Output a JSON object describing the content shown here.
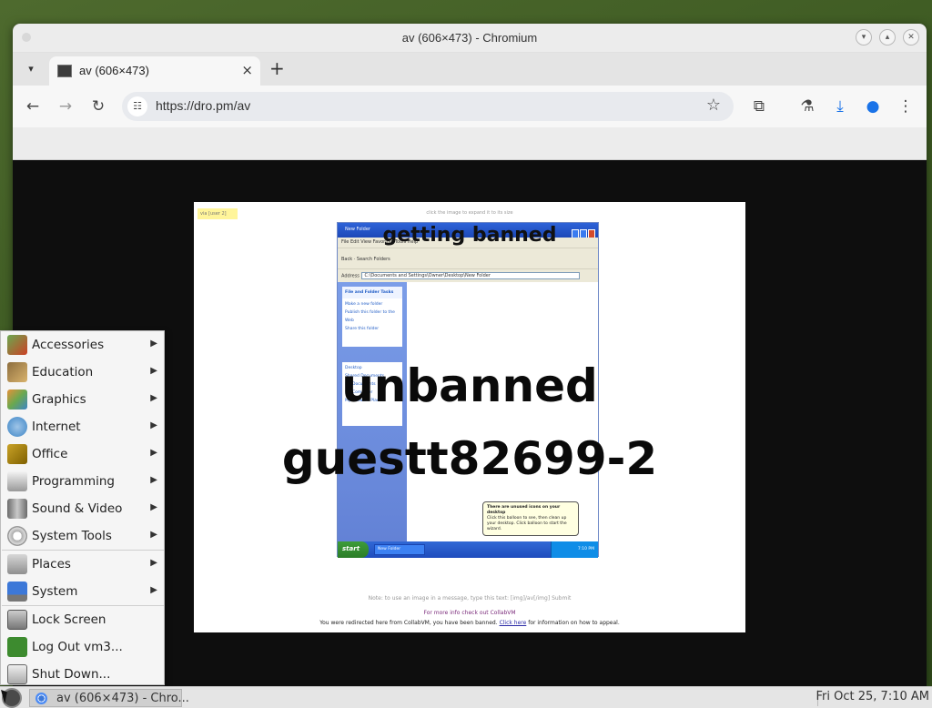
{
  "browser": {
    "window_title": "av (606×473) - Chromium",
    "tab_title": "av (606×473)",
    "url": "https://dro.pm/av"
  },
  "image": {
    "tag": "via [user 2]",
    "top_note": "click the image to expand it to its size",
    "xp_title": "New Folder",
    "xp_menu": "File  Edit  View  Favorites  Tools  Help",
    "xp_toolbar": "Back   ·   Search   Folders",
    "xp_address_label": "Address",
    "xp_address_value": "C:\\Documents and Settings\\Owner\\Desktop\\New Folder",
    "xp_panel_1_title": "File and Folder Tasks",
    "xp_panel_1_items": [
      "Make a new folder",
      "Publish this folder to the Web",
      "Share this folder"
    ],
    "xp_panel_2_items": [
      "Desktop",
      "Shared Documents",
      "My Documents",
      "My Computer",
      "My Network Places"
    ],
    "xp_start": "start",
    "xp_task": "New Folder",
    "xp_tray": "7:10 PM",
    "xp_balloon_title": "There are unused icons on your desktop",
    "xp_balloon_text": "Click this balloon to see, then clean up your desktop. Click balloon to start the wizard.",
    "caption_top": "getting banned",
    "caption_line1": "unbanned",
    "caption_line2": "guestt82699-2",
    "foot_1": "Note: to use an image in a message, type this text: [img]/av[/img]  Submit",
    "foot_2": "For more info check out CollabVM",
    "foot_3_a": "You were redirected here from CollabVM, you have been banned.",
    "foot_3_link": "Click here",
    "foot_3_b": "for information on how to appeal."
  },
  "app_menu": {
    "items": [
      {
        "label": "Accessories",
        "icon": "accessories-icon",
        "submenu": true
      },
      {
        "label": "Education",
        "icon": "education-icon",
        "submenu": true
      },
      {
        "label": "Graphics",
        "icon": "graphics-icon",
        "submenu": true
      },
      {
        "label": "Internet",
        "icon": "internet-icon",
        "submenu": true
      },
      {
        "label": "Office",
        "icon": "office-icon",
        "submenu": true
      },
      {
        "label": "Programming",
        "icon": "programming-icon",
        "submenu": true
      },
      {
        "label": "Sound & Video",
        "icon": "sound-video-icon",
        "submenu": true
      },
      {
        "label": "System Tools",
        "icon": "system-tools-icon",
        "submenu": true
      },
      {
        "label": "Places",
        "icon": "places-icon",
        "submenu": true
      },
      {
        "label": "System",
        "icon": "system-icon",
        "submenu": true
      },
      {
        "label": "Lock Screen",
        "icon": "lock-screen-icon",
        "submenu": false
      },
      {
        "label": "Log Out vm3...",
        "icon": "log-out-icon",
        "submenu": false
      },
      {
        "label": "Shut Down...",
        "icon": "shut-down-icon",
        "submenu": false
      }
    ],
    "arrow": "▶"
  },
  "taskbar": {
    "task_label": "av (606×473) - Chro...",
    "clock": "Fri Oct 25,  7:10 AM"
  },
  "colors": {
    "desktop": "#3d5a22",
    "xp_blue": "#2e63d8",
    "menu_bg": "#f5f5f5"
  }
}
